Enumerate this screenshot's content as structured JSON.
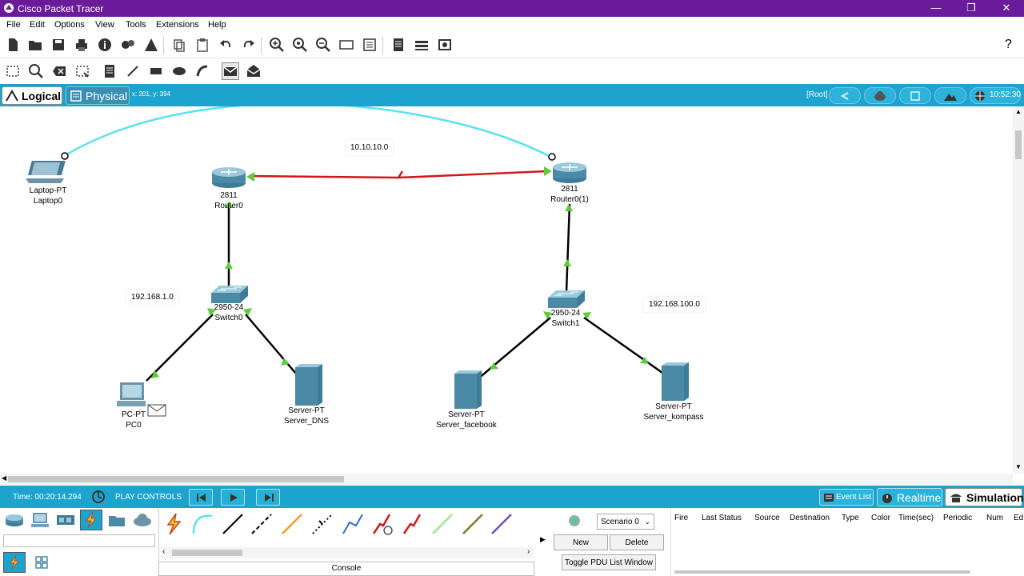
{
  "window": {
    "title": "Cisco Packet Tracer",
    "min": "—",
    "max": "❐",
    "close": "✕"
  },
  "menu": [
    "File",
    "Edit",
    "Options",
    "View",
    "Tools",
    "Extensions",
    "Help"
  ],
  "help_glyph": "?",
  "views": {
    "logical": "Logical",
    "physical": "Physical",
    "coords": "x: 201, y: 394",
    "root": "[Root]",
    "clock": "10:52:30"
  },
  "topology": {
    "network_labels": [
      "10.10.10.0",
      "192.168.1.0",
      "192.168.100.0"
    ],
    "devices": [
      {
        "model": "Laptop-PT",
        "name": "Laptop0"
      },
      {
        "model": "2811",
        "name": "Router0"
      },
      {
        "model": "2811",
        "name": "Router0(1)"
      },
      {
        "model": "2950-24",
        "name": "Switch0"
      },
      {
        "model": "2950-24",
        "name": "Switch1"
      },
      {
        "model": "PC-PT",
        "name": "PC0"
      },
      {
        "model": "Server-PT",
        "name": "Server_DNS"
      },
      {
        "model": "Server-PT",
        "name": "Server_facebook"
      },
      {
        "model": "Server-PT",
        "name": "Server_kompass"
      }
    ],
    "colors": {
      "serial_link": "#d0181b",
      "console_link": "#5ae3ee",
      "straight_link": "#000000",
      "port_up": "#5ecb3a"
    }
  },
  "status": {
    "time": "Time: 00:20:14.294",
    "play_controls": "PLAY CONTROLS",
    "event_list": "Event List",
    "realtime": "Realtime",
    "simulation": "Simulation"
  },
  "console": "Console",
  "scenario": {
    "select": "Scenario 0",
    "new": "New",
    "delete": "Delete",
    "toggle": "Toggle PDU List Window"
  },
  "pdu_columns": [
    "Fire",
    "Last Status",
    "Source",
    "Destination",
    "Type",
    "Color",
    "Time(sec)",
    "Periodic",
    "Num",
    "Ed"
  ],
  "accent": "#1ca4cf",
  "titlebar_color": "#6a1b9a"
}
